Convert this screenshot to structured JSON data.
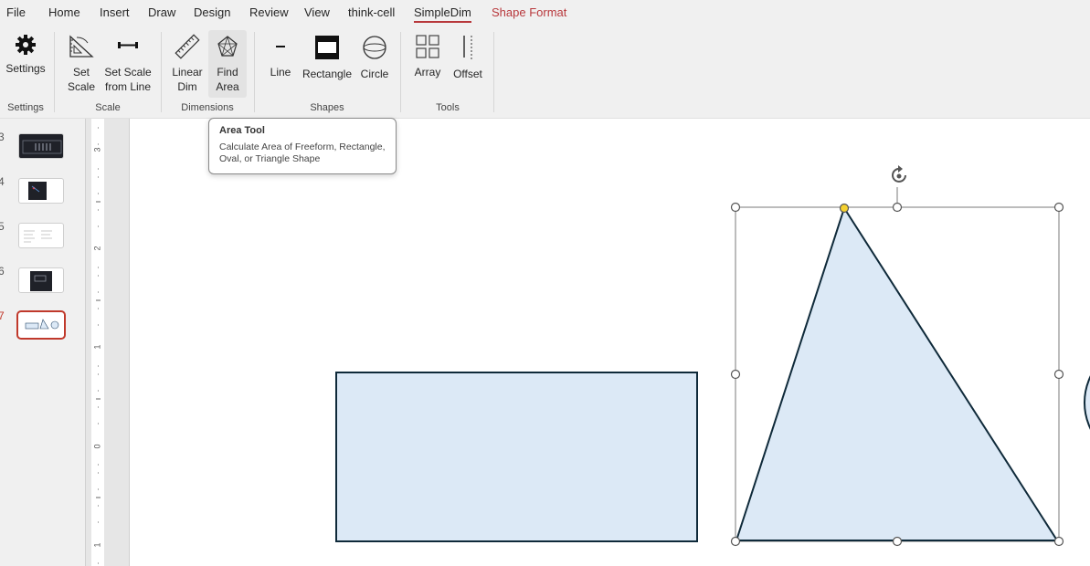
{
  "menu": {
    "items": [
      {
        "label": "File"
      },
      {
        "label": "Home"
      },
      {
        "label": "Insert"
      },
      {
        "label": "Draw"
      },
      {
        "label": "Design"
      },
      {
        "label": "Review"
      },
      {
        "label": "View"
      },
      {
        "label": "think-cell"
      },
      {
        "label": "SimpleDim"
      },
      {
        "label": "Shape Format"
      }
    ],
    "active": "SimpleDim",
    "contextual": "Shape Format"
  },
  "ribbon": {
    "settings": {
      "label": "Settings",
      "icon": "gear-icon",
      "group": "Settings"
    },
    "scale": {
      "group": "Scale",
      "set_scale": {
        "label": "Set\nScale",
        "icon": "set-square-icon"
      },
      "scale_from_line": {
        "label": "Set Scale\nfrom Line",
        "icon": "dimension-line-icon"
      }
    },
    "dimensions": {
      "group": "Dimensions",
      "linear_dim": {
        "label": "Linear\nDim",
        "icon": "ruler-icon"
      },
      "find_area": {
        "label": "Find\nArea",
        "icon": "area-icon"
      }
    },
    "shapes": {
      "group": "Shapes",
      "line": {
        "label": "Line",
        "icon": "line-icon"
      },
      "rectangle": {
        "label": "Rectangle",
        "icon": "rectangle-icon"
      },
      "circle": {
        "label": "Circle",
        "icon": "circle-icon"
      }
    },
    "tools": {
      "group": "Tools",
      "array": {
        "label": "Array",
        "icon": "array-icon"
      },
      "offset": {
        "label": "Offset",
        "icon": "offset-icon"
      }
    }
  },
  "tooltip": {
    "title": "Area Tool",
    "text": "Calculate Area of Freeform, Rectangle, Oval, or Triangle Shape"
  },
  "slides": [
    {
      "number": "3"
    },
    {
      "number": "4"
    },
    {
      "number": "5"
    },
    {
      "number": "6"
    },
    {
      "number": "7"
    }
  ],
  "current_slide": "7",
  "ruler": {
    "numbers": [
      "3",
      "2",
      "1",
      "0",
      "1"
    ]
  },
  "colors": {
    "accent": "#b8383c",
    "shape_fill": "#dce9f6",
    "shape_stroke": "#0f2a3a",
    "handle_yellow": "#f5d130"
  }
}
